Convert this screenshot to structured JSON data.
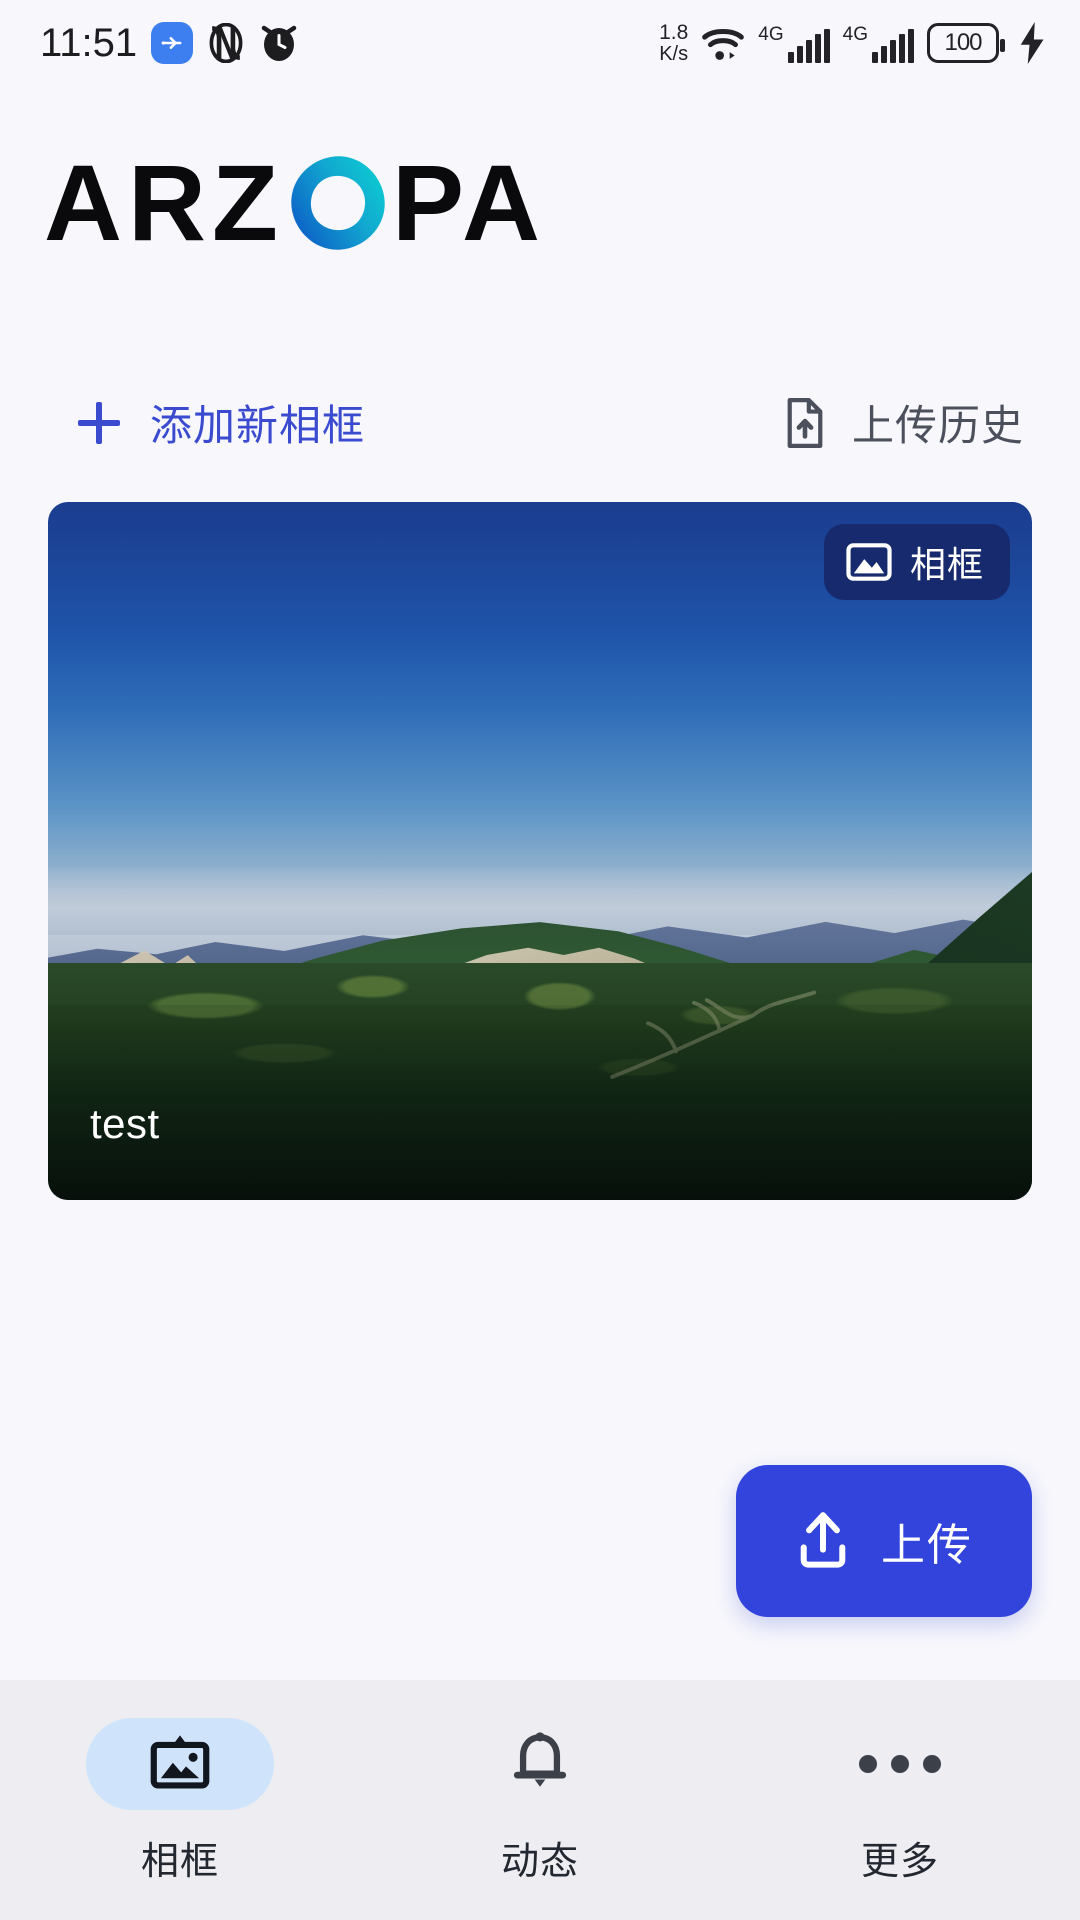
{
  "status_bar": {
    "time": "11:51",
    "icons_left": [
      "usb-icon",
      "nfc-icon",
      "alarm-icon"
    ],
    "net_speed_value": "1.8",
    "net_speed_unit": "K/s",
    "wifi": "wifi-icon",
    "sim1_label": "4G",
    "sim2_label": "4G",
    "battery_level": "100",
    "charging": "charging-bolt-icon"
  },
  "brand": {
    "name_part1": "ARZ",
    "name_part2": "PA",
    "logo_gradient_start": "#10d2d2",
    "logo_gradient_end": "#0b4fc4"
  },
  "actions": {
    "add_frame_label": "添加新相框",
    "add_frame_color": "#3a4bd0",
    "upload_history_label": "上传历史",
    "upload_history_color": "#4b505c"
  },
  "frame_card": {
    "badge_label": "相框",
    "badge_color": "#162a6d",
    "title": "test",
    "photo_description": "mountain-landscape-photo"
  },
  "upload_button": {
    "label": "上传",
    "color": "#3344dd",
    "icon": "upload-icon"
  },
  "bottom_nav": {
    "items": [
      {
        "label": "相框",
        "icon": "photo-frame-icon",
        "active": true
      },
      {
        "label": "动态",
        "icon": "bell-icon",
        "active": false
      },
      {
        "label": "更多",
        "icon": "more-dots-icon",
        "active": false
      }
    ],
    "active_pill_color": "#cfe4fb",
    "background": "#ededf2"
  }
}
